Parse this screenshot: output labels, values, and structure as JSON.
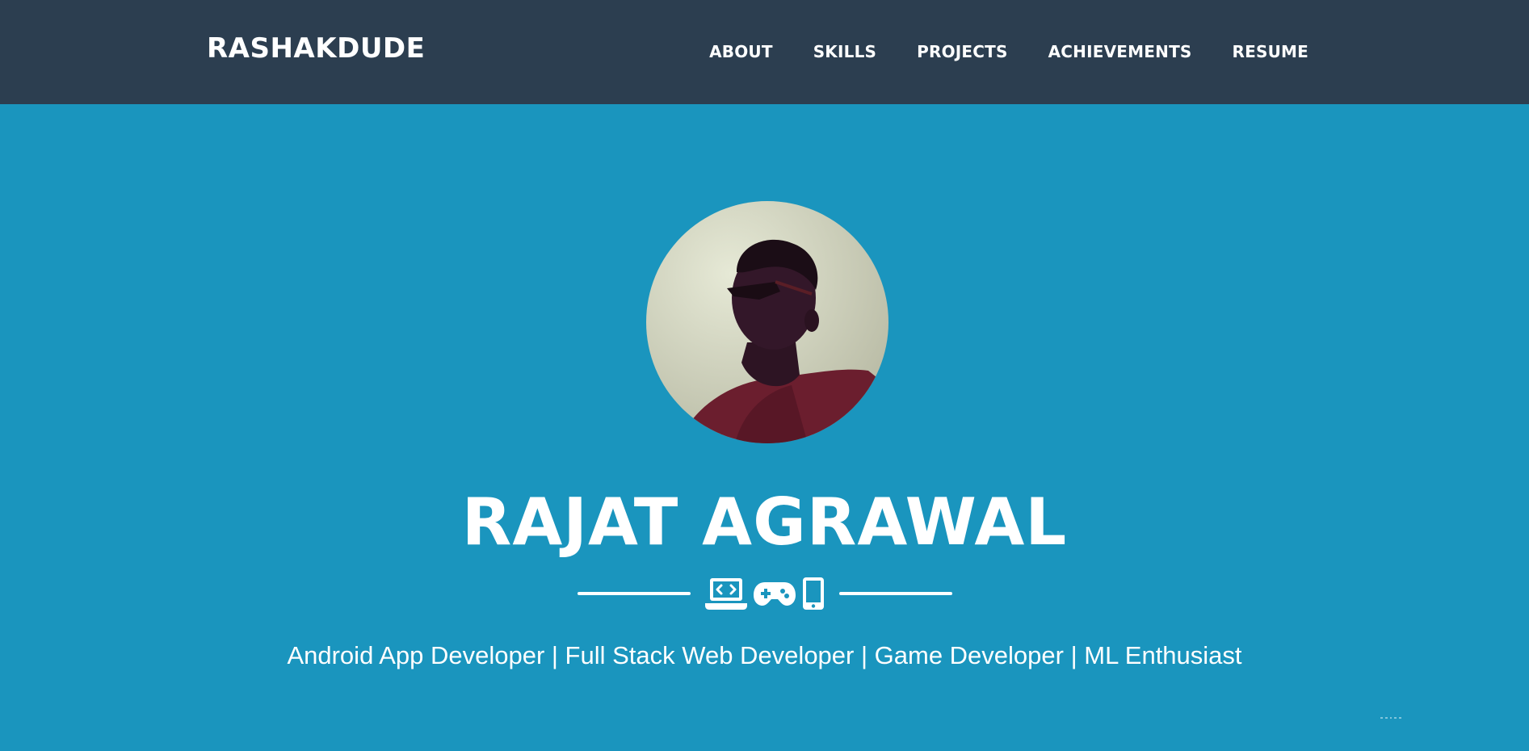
{
  "navbar": {
    "brand": "RASHAKDUDE",
    "links": [
      "ABOUT",
      "SKILLS",
      "PROJECTS",
      "ACHIEVEMENTS",
      "RESUME"
    ]
  },
  "hero": {
    "name": "RAJAT AGRAWAL",
    "divider_icons": [
      "laptop-code-icon",
      "gamepad-icon",
      "mobile-phone-icon"
    ],
    "subtitle": "Android App Developer | Full Stack Web Developer | Game Developer | ML Enthusiast"
  },
  "colors": {
    "navbar_bg": "#2c3e50",
    "hero_bg": "#1a95be",
    "text": "#ffffff"
  }
}
